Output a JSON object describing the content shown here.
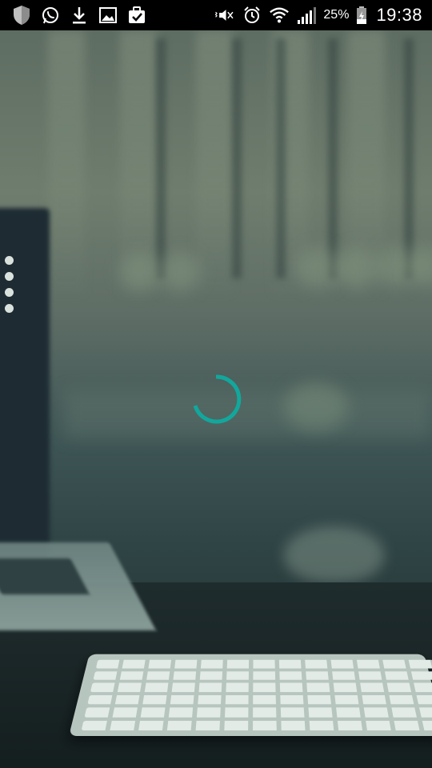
{
  "status_bar": {
    "left_icons": [
      "shield-icon",
      "whatsapp-icon",
      "download-icon",
      "image-icon",
      "clipboard-check-icon"
    ],
    "right_icons": [
      "vibrate-mute-icon",
      "alarm-icon",
      "wifi-icon",
      "signal-icon"
    ],
    "battery_percent": "25%",
    "time": "19:38"
  },
  "loading": {
    "indicator_color": "#12a79d",
    "state": "loading"
  },
  "menu_dots": {
    "count": 4
  },
  "colors": {
    "status_bar": "#000000",
    "accent": "#12a79d"
  }
}
